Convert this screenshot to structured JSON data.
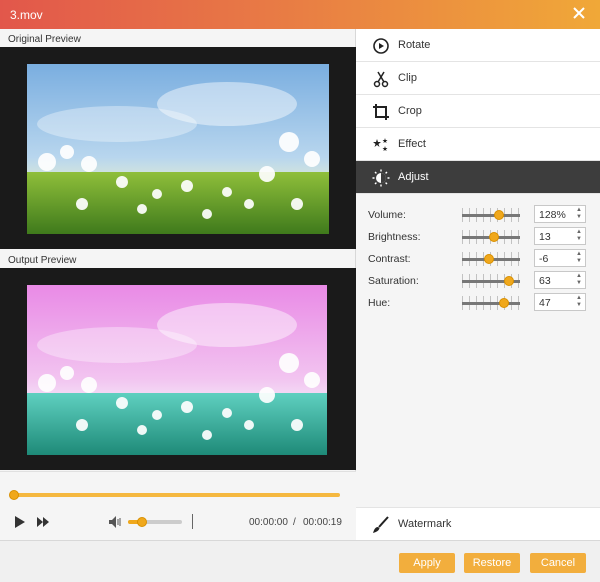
{
  "window": {
    "title": "3.mov"
  },
  "left": {
    "original_label": "Original Preview",
    "output_label": "Output Preview"
  },
  "playback": {
    "current_time": "00:00:00",
    "separator": "/",
    "total_time": "00:00:19",
    "seek_fraction": 0.0,
    "volume_fraction": 0.25
  },
  "menu": {
    "rotate": "Rotate",
    "clip": "Clip",
    "crop": "Crop",
    "effect": "Effect",
    "adjust": "Adjust",
    "watermark": "Watermark"
  },
  "adjust": {
    "volume": {
      "label": "Volume:",
      "value": "128%",
      "level": 0.64
    },
    "brightness": {
      "label": "Brightness:",
      "value": "13",
      "level": 0.56
    },
    "contrast": {
      "label": "Contrast:",
      "value": "-6",
      "level": 0.47
    },
    "saturation": {
      "label": "Saturation:",
      "value": "63",
      "level": 0.81
    },
    "hue": {
      "label": "Hue:",
      "value": "47",
      "level": 0.73
    }
  },
  "footer": {
    "apply": "Apply",
    "restore": "Restore",
    "cancel": "Cancel"
  },
  "colors": {
    "accent": "#f2ae3d",
    "titlebar_start": "#e2574b",
    "titlebar_end": "#f0a838",
    "active_menu": "#3d3d3d"
  }
}
